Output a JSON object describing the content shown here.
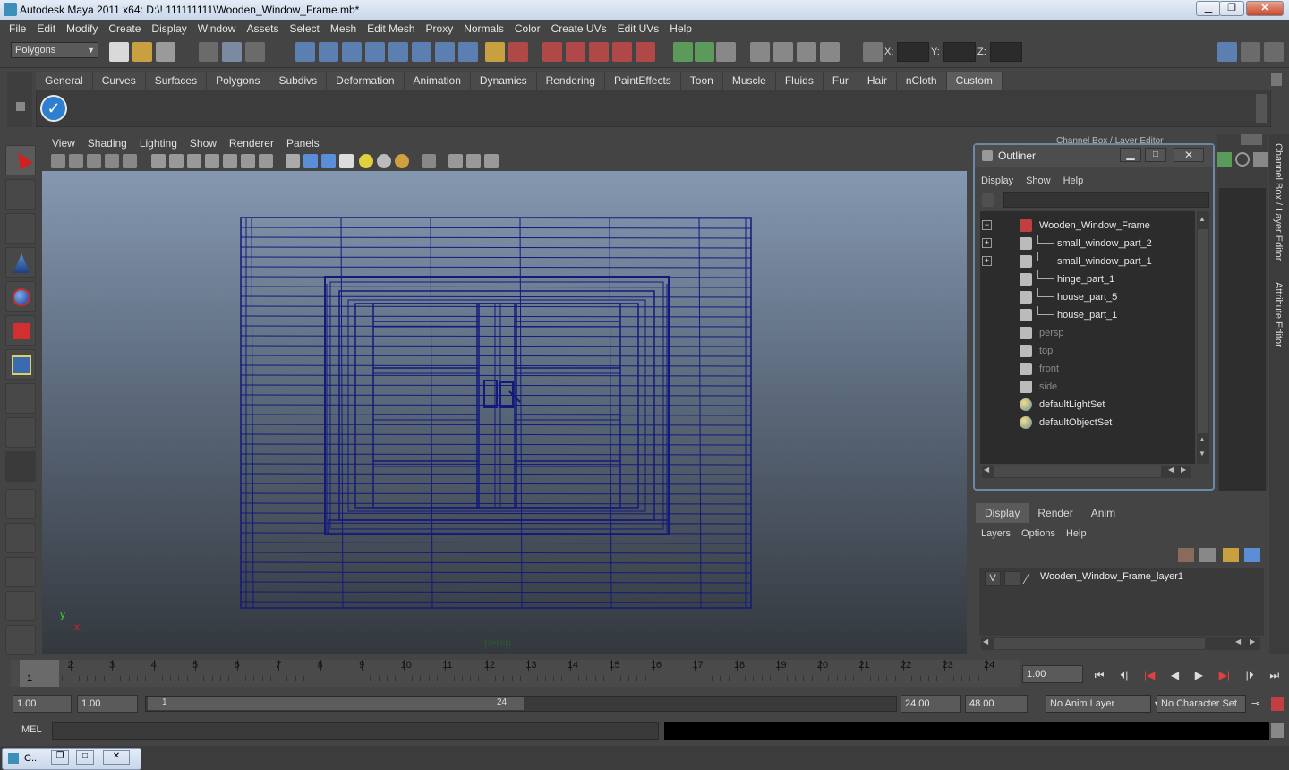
{
  "window": {
    "title": "Autodesk Maya 2011 x64: D:\\! 111111111\\Wooden_Window_Frame.mb*",
    "minimize": "▁",
    "maximize": "❐",
    "close": "✕"
  },
  "menubar": [
    "File",
    "Edit",
    "Modify",
    "Create",
    "Display",
    "Window",
    "Assets",
    "Select",
    "Mesh",
    "Edit Mesh",
    "Proxy",
    "Normals",
    "Color",
    "Create UVs",
    "Edit UVs",
    "Help"
  ],
  "statusline": {
    "mode": "Polygons",
    "x_label": "X:",
    "y_label": "Y:",
    "z_label": "Z:"
  },
  "shelf": {
    "tabs": [
      "General",
      "Curves",
      "Surfaces",
      "Polygons",
      "Subdivs",
      "Deformation",
      "Animation",
      "Dynamics",
      "Rendering",
      "PaintEffects",
      "Toon",
      "Muscle",
      "Fluids",
      "Fur",
      "Hair",
      "nCloth",
      "Custom"
    ],
    "active_tab": "Custom"
  },
  "viewport": {
    "menu": [
      "View",
      "Shading",
      "Lighting",
      "Show",
      "Renderer",
      "Panels"
    ],
    "camera_label": "persp",
    "axis_y": "y",
    "axis_x": "x",
    "wire_color": "#121a7a"
  },
  "outliner": {
    "title": "Outliner",
    "menu": [
      "Display",
      "Show",
      "Help"
    ],
    "items": [
      {
        "label": "Wooden_Window_Frame",
        "dim": false,
        "expander": "−"
      },
      {
        "label": "small_window_part_2",
        "dim": false,
        "expander": "+"
      },
      {
        "label": "small_window_part_1",
        "dim": false,
        "expander": "+"
      },
      {
        "label": "hinge_part_1",
        "dim": false,
        "expander": ""
      },
      {
        "label": "house_part_5",
        "dim": false,
        "expander": ""
      },
      {
        "label": "house_part_1",
        "dim": false,
        "expander": ""
      },
      {
        "label": "persp",
        "dim": true,
        "expander": ""
      },
      {
        "label": "top",
        "dim": true,
        "expander": ""
      },
      {
        "label": "front",
        "dim": true,
        "expander": ""
      },
      {
        "label": "side",
        "dim": true,
        "expander": ""
      },
      {
        "label": "defaultLightSet",
        "dim": false,
        "expander": ""
      },
      {
        "label": "defaultObjectSet",
        "dim": false,
        "expander": ""
      }
    ]
  },
  "channelbox": {
    "title": "Channel Box / Layer Editor",
    "side_tab_1": "Channel Box / Layer Editor",
    "side_tab_2": "Attribute Editor"
  },
  "layers": {
    "tabs": [
      "Display",
      "Render",
      "Anim"
    ],
    "active_tab": "Display",
    "menu": [
      "Layers",
      "Options",
      "Help"
    ],
    "rows": [
      {
        "visible": "V",
        "name": "Wooden_Window_Frame_layer1"
      }
    ]
  },
  "timeline": {
    "ticks": [
      "1",
      "2",
      "3",
      "4",
      "5",
      "6",
      "7",
      "8",
      "9",
      "10",
      "11",
      "12",
      "13",
      "14",
      "15",
      "16",
      "17",
      "18",
      "19",
      "20",
      "21",
      "22",
      "23",
      "24"
    ],
    "current_frame_marker": "1",
    "current_time": "1.00"
  },
  "range": {
    "start": "1.00",
    "playback_start": "1.00",
    "slider_start": "1",
    "slider_end": "24",
    "playback_end": "24.00",
    "end": "48.00",
    "anim_layer": "No Anim Layer",
    "character_set": "No Character Set"
  },
  "command": {
    "label": "MEL"
  },
  "taskbar": {
    "label": "C..."
  }
}
